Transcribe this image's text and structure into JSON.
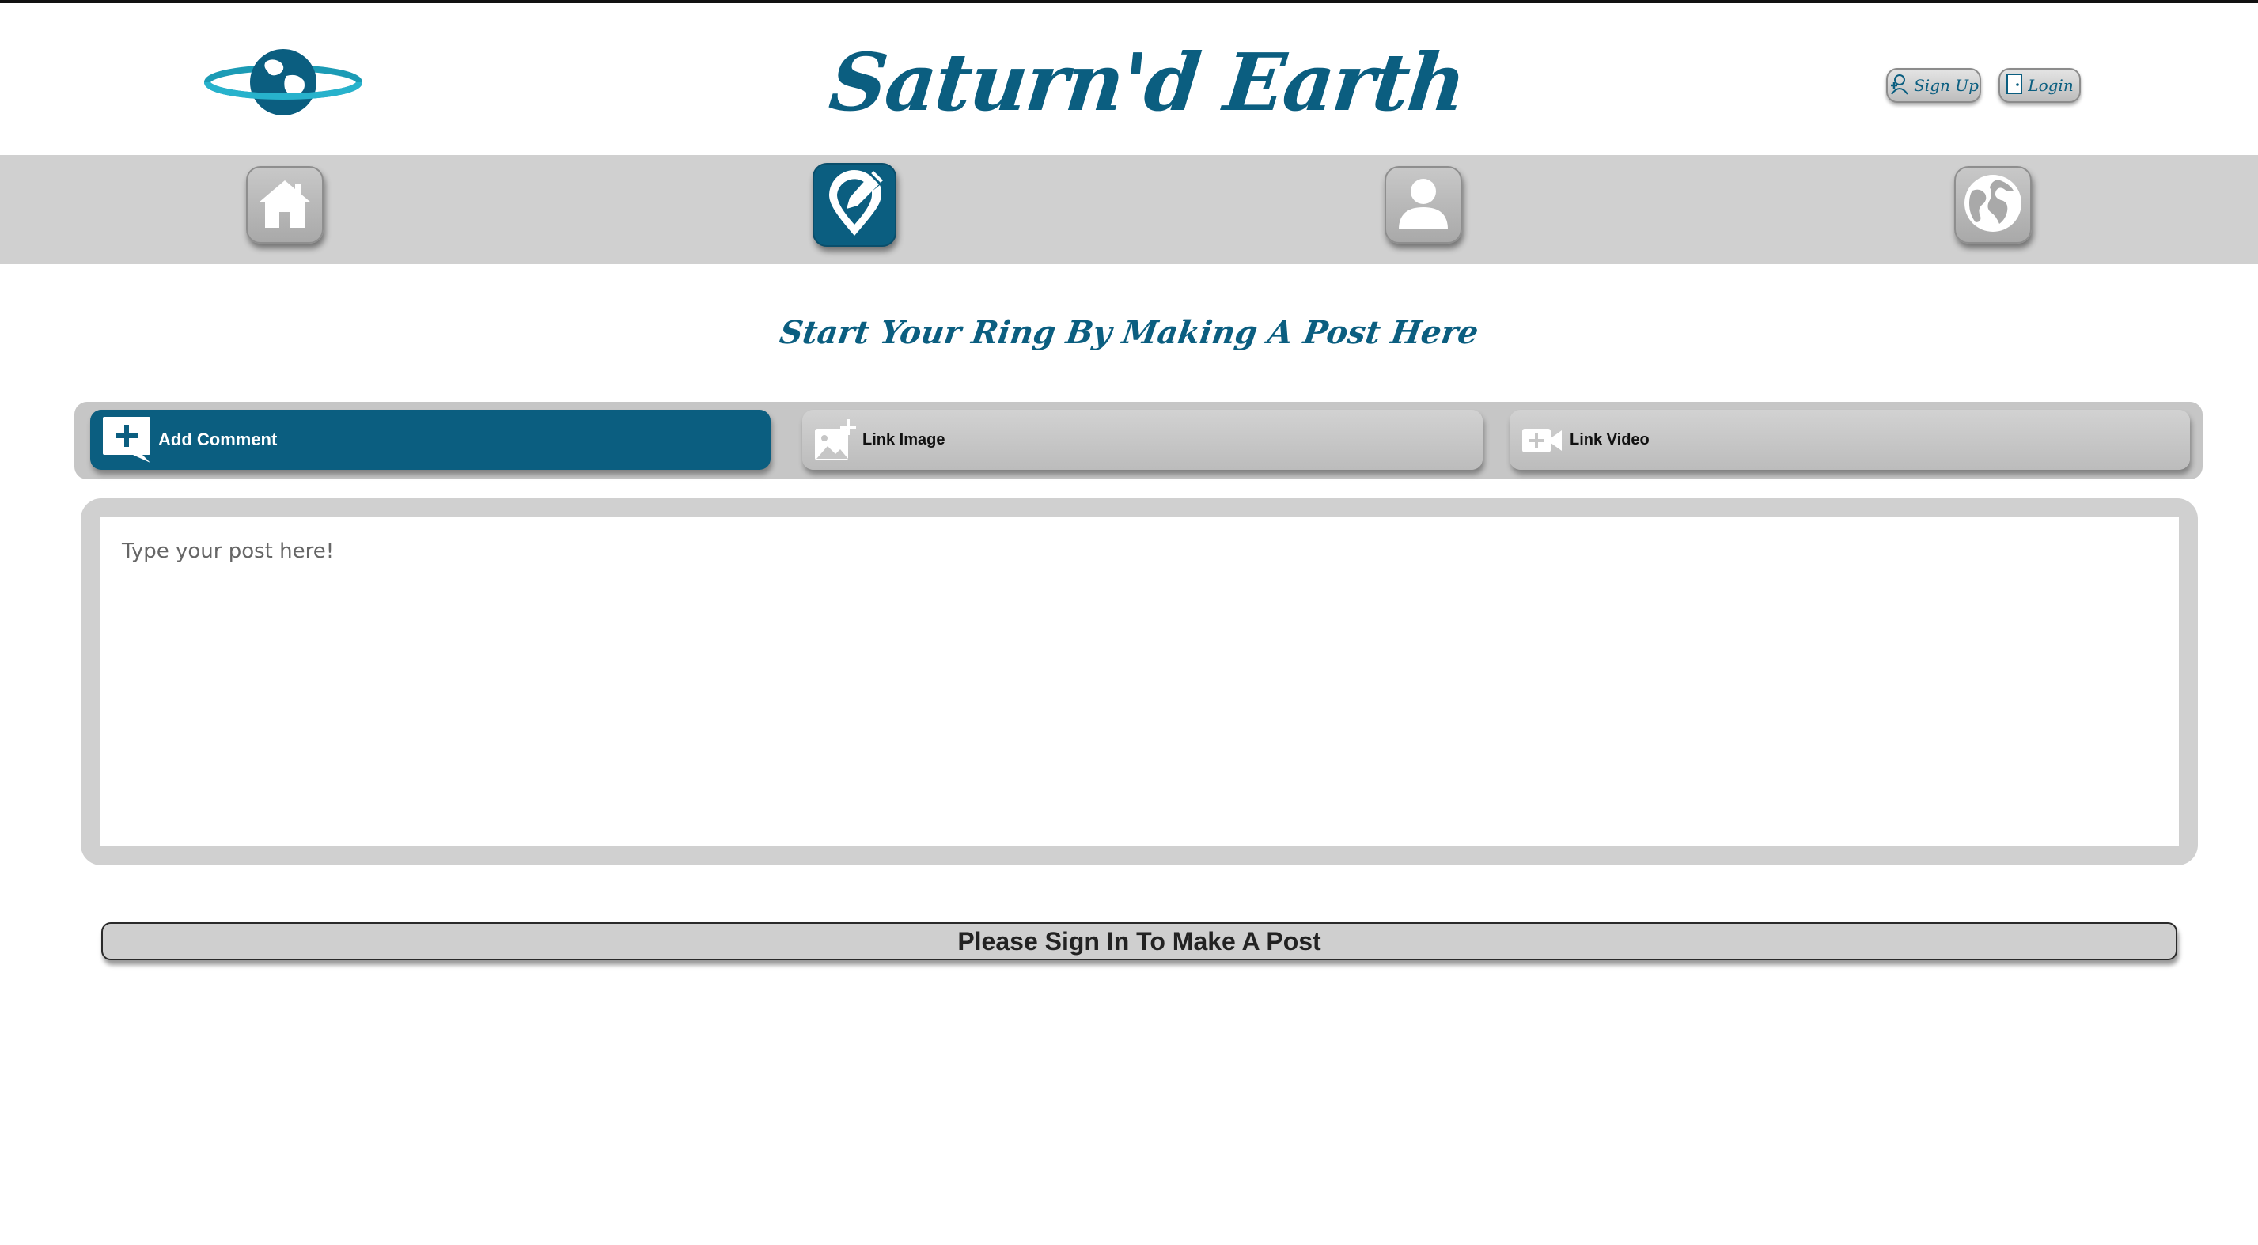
{
  "header": {
    "site_title": "Saturn'd Earth",
    "signup_label": "Sign Up",
    "login_label": "Login"
  },
  "nav": {
    "items": [
      {
        "name": "home",
        "icon": "home-icon",
        "active": false
      },
      {
        "name": "make-post",
        "icon": "pin-edit-icon",
        "active": true
      },
      {
        "name": "profile",
        "icon": "user-icon",
        "active": false
      },
      {
        "name": "world",
        "icon": "globe-icon",
        "active": false
      }
    ]
  },
  "main": {
    "subtitle": "Start Your Ring By Making A Post Here",
    "tabs": [
      {
        "label": "Add Comment",
        "icon": "add-comment-icon",
        "active": true
      },
      {
        "label": "Link Image",
        "icon": "add-image-icon",
        "active": false
      },
      {
        "label": "Link Video",
        "icon": "add-video-icon",
        "active": false
      }
    ],
    "post_placeholder": "Type your post here!",
    "post_value": "",
    "signin_message": "Please Sign In To Make A Post"
  },
  "colors": {
    "brand": "#0b5e80",
    "nav_bg": "#d0d0d0",
    "button_grey": "#c6c6c6"
  }
}
